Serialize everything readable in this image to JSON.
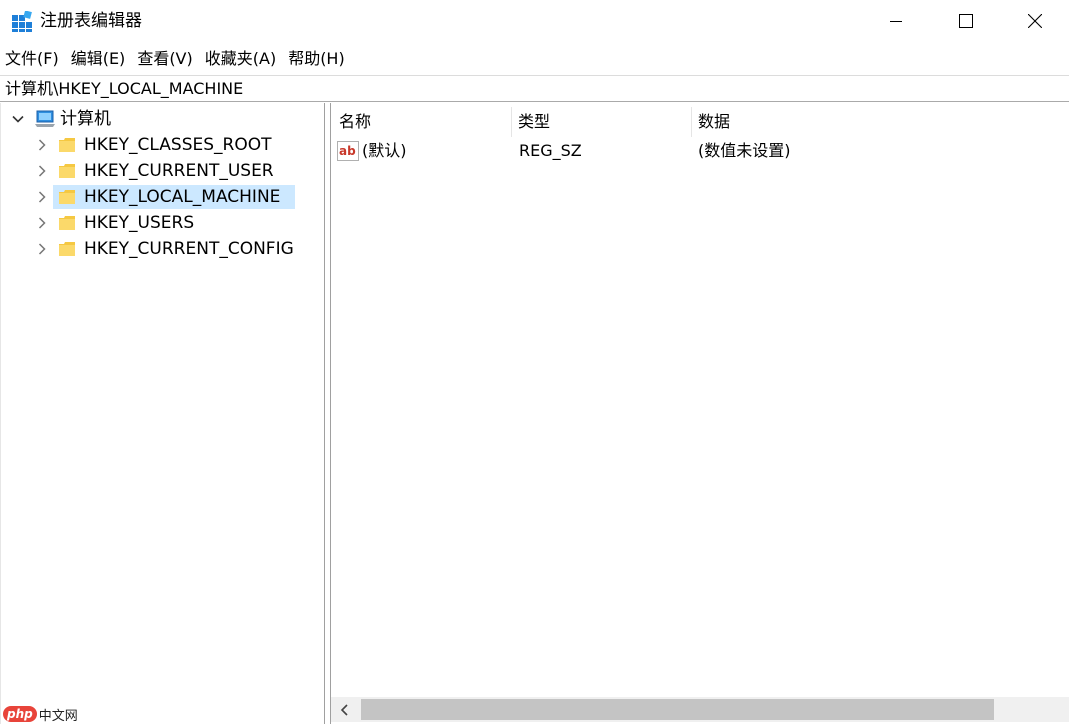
{
  "window": {
    "title": "注册表编辑器",
    "icon": "regedit-icon"
  },
  "menu": {
    "items": [
      {
        "label": "文件(F)"
      },
      {
        "label": "编辑(E)"
      },
      {
        "label": "查看(V)"
      },
      {
        "label": "收藏夹(A)"
      },
      {
        "label": "帮助(H)"
      }
    ]
  },
  "address": {
    "path": "计算机\\HKEY_LOCAL_MACHINE"
  },
  "tree": {
    "root": {
      "label": "计算机",
      "expanded": true,
      "icon": "computer-icon"
    },
    "children": [
      {
        "label": "HKEY_CLASSES_ROOT",
        "selected": false
      },
      {
        "label": "HKEY_CURRENT_USER",
        "selected": false
      },
      {
        "label": "HKEY_LOCAL_MACHINE",
        "selected": true
      },
      {
        "label": "HKEY_USERS",
        "selected": false
      },
      {
        "label": "HKEY_CURRENT_CONFIG",
        "selected": false
      }
    ]
  },
  "list": {
    "columns": [
      "名称",
      "类型",
      "数据"
    ],
    "rows": [
      {
        "name": "(默认)",
        "type": "REG_SZ",
        "data": "(数值未设置)",
        "icon": "string-value-icon"
      }
    ]
  },
  "colors": {
    "selection": "#cce8ff",
    "folder": "#f5c842"
  },
  "watermark": {
    "logo": "php",
    "text": "中文网"
  }
}
